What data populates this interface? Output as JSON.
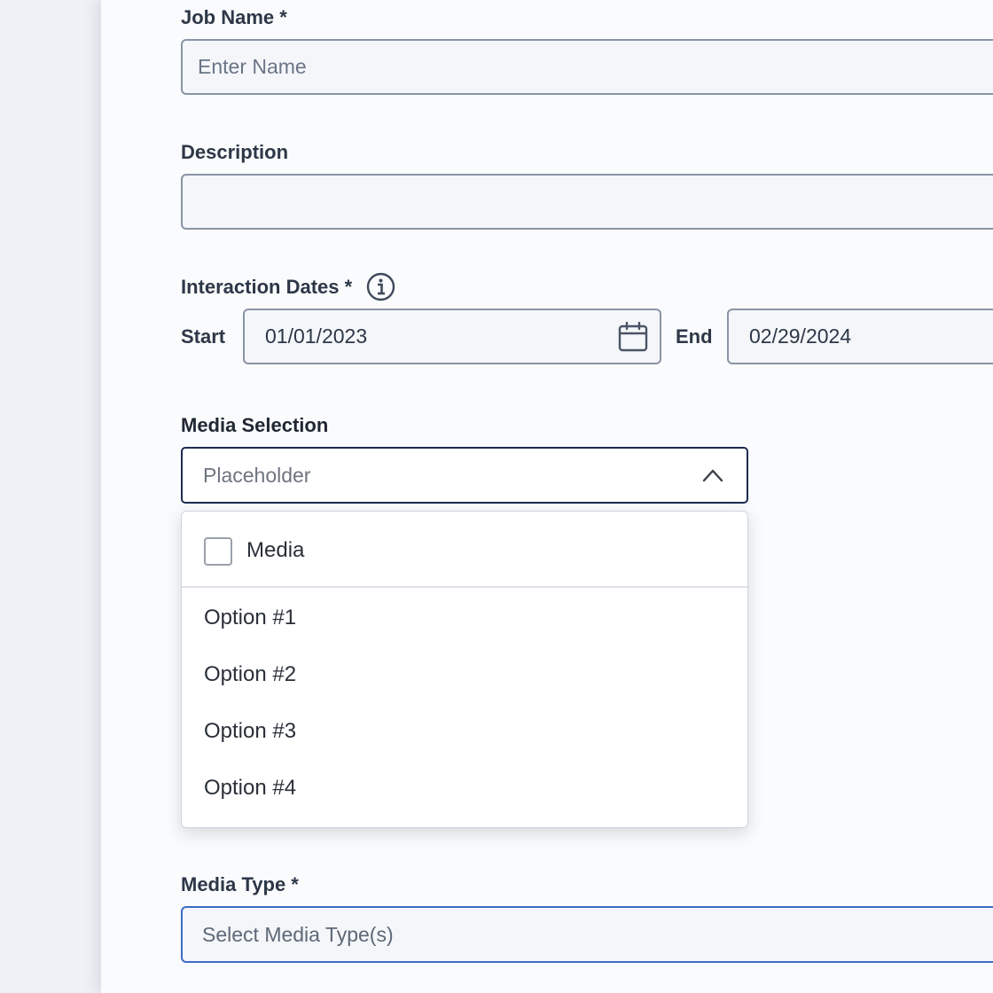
{
  "form": {
    "job_name": {
      "label": "Job Name *",
      "placeholder": "Enter Name",
      "value": ""
    },
    "description": {
      "label": "Description",
      "value": ""
    },
    "interaction_dates": {
      "label": "Interaction Dates *",
      "info_icon": "info-circle-icon",
      "start_label": "Start",
      "start_value": "01/01/2023",
      "end_label": "End",
      "end_value": "02/29/2024",
      "calendar_icon": "calendar-icon"
    },
    "media_selection": {
      "label": "Media Selection",
      "placeholder": "Placeholder",
      "expanded": true,
      "chevron_icon": "chevron-up-icon",
      "dropdown": {
        "select_all_label": "Media",
        "select_all_checked": false,
        "options": [
          "Option #1",
          "Option #2",
          "Option #3",
          "Option #4"
        ]
      }
    },
    "media_type": {
      "label": "Media Type *",
      "placeholder": "Select Media Type(s)"
    }
  },
  "colors": {
    "panel_background": "#fafbfc",
    "label_text": "#2d3748",
    "field_border": "#8a94a6",
    "select_focus_border": "#1c2b4f",
    "media_type_border": "#3d6cc8"
  }
}
